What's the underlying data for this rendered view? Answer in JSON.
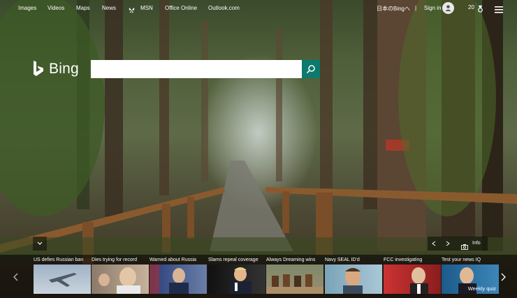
{
  "nav": {
    "links": [
      "Images",
      "Videos",
      "Maps",
      "News",
      "MSN",
      "Office Online",
      "Outlook.com"
    ]
  },
  "header": {
    "region_link": "日本のBingへ",
    "sign_in": "Sign in",
    "rewards_count": "20"
  },
  "brand": {
    "logo_text": "Bing"
  },
  "search": {
    "value": "",
    "placeholder": ""
  },
  "image_bar": {
    "info_label": "Info"
  },
  "news": [
    {
      "title": "US defies Russian ban",
      "badge": ""
    },
    {
      "title": "Dies trying for record",
      "badge": ""
    },
    {
      "title": "Warned about Russia",
      "badge": ""
    },
    {
      "title": "Slams repeal coverage",
      "badge": ""
    },
    {
      "title": "Always Dreaming wins",
      "badge": ""
    },
    {
      "title": "Navy SEAL ID'd",
      "badge": ""
    },
    {
      "title": "FCC investigating",
      "badge": ""
    },
    {
      "title": "Test your news IQ",
      "badge": "Weekly quiz"
    }
  ],
  "colors": {
    "accent": "#0c7a6c"
  }
}
